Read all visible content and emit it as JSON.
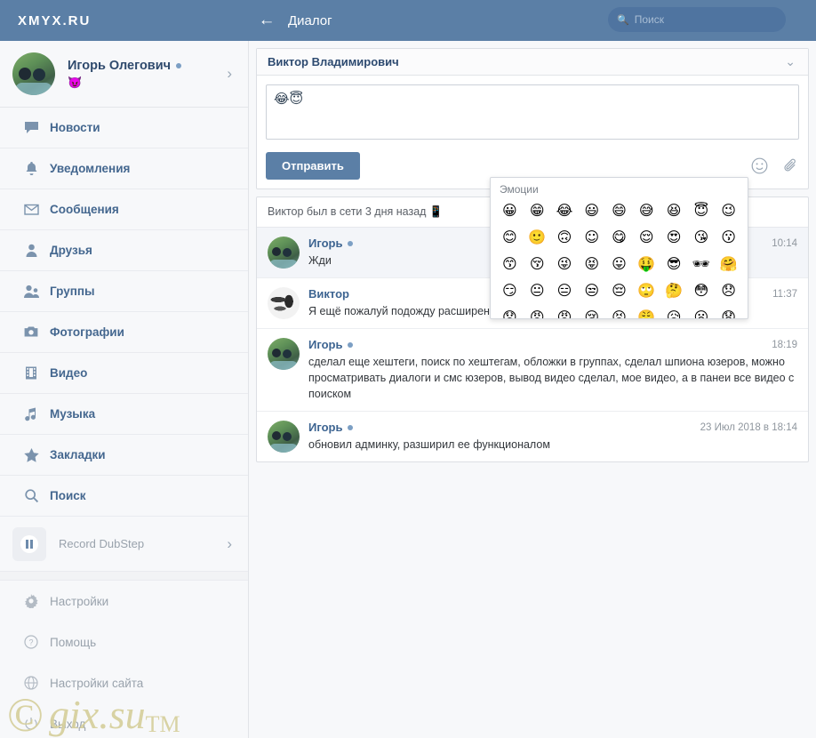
{
  "topbar": {
    "brand": "XMYX.RU",
    "back_icon": "arrow-left-icon",
    "title": "Диалог",
    "search_placeholder": "Поиск",
    "search_icon": "search-icon",
    "bg_color": "#5b7fa6"
  },
  "sidebar": {
    "profile": {
      "name": "Игорь Олегович",
      "status_emoji": "😈",
      "online": true,
      "chevron": "›"
    },
    "items": [
      {
        "label": "Новости",
        "icon": "news-bubble-icon"
      },
      {
        "label": "Уведомления",
        "icon": "bell-icon"
      },
      {
        "label": "Сообщения",
        "icon": "envelope-icon"
      },
      {
        "label": "Друзья",
        "icon": "user-icon"
      },
      {
        "label": "Группы",
        "icon": "users-icon"
      },
      {
        "label": "Фотографии",
        "icon": "camera-icon"
      },
      {
        "label": "Видео",
        "icon": "film-icon"
      },
      {
        "label": "Музыка",
        "icon": "music-note-icon"
      },
      {
        "label": "Закладки",
        "icon": "star-icon"
      },
      {
        "label": "Поиск",
        "icon": "search-icon"
      }
    ],
    "player": {
      "title": "Record DubStep",
      "button_icon": "pause-icon",
      "chevron": "›"
    },
    "footer_items": [
      {
        "label": "Настройки",
        "icon": "gear-icon"
      },
      {
        "label": "Помощь",
        "icon": "question-circle-icon"
      },
      {
        "label": "Настройки сайта",
        "icon": "globe-icon"
      },
      {
        "label": "Выход",
        "icon": "power-icon"
      }
    ]
  },
  "conversation": {
    "header_name": "Виктор Владимирович",
    "header_chevron": "⌄",
    "compose": {
      "value": "😂😇",
      "placeholder": "",
      "send_label": "Отправить",
      "emoji_icon": "smiley-face-icon",
      "attach_icon": "paperclip-icon"
    },
    "status_line": "Виктор был в сети 3 дня назад 📱",
    "messages": [
      {
        "author": "Игорь",
        "online": true,
        "text": "Жди",
        "time": "10:14",
        "avatar": "photo-two-people",
        "highlight": true
      },
      {
        "author": "Виктор",
        "online": false,
        "text": "Я ещё пожалуй подожду расширения с",
        "time": "11:37",
        "avatar": "eagle-emblem",
        "highlight": false
      },
      {
        "author": "Игорь",
        "online": true,
        "text": "сделал еще хештеги, поиск по хештегам, обложки в группах, сделал шпиона юзеров, можно просматривать диалоги и смс юзеров, вывод видео сделал, мое видео, а в панеи все видео с поиском",
        "time": "18:19",
        "avatar": "photo-two-people",
        "highlight": false
      },
      {
        "author": "Игорь",
        "online": true,
        "text": "обновил админку, разширил ее функционалом",
        "time": "23 Июл 2018 в 18:14",
        "avatar": "photo-two-people",
        "highlight": false
      }
    ]
  },
  "emoji_picker": {
    "title": "Эмоции",
    "rows": [
      [
        "😀",
        "😁",
        "😂",
        "😃",
        "😄",
        "😅",
        "😆",
        "😇",
        "😉"
      ],
      [
        "😊",
        "🙂",
        "🙃",
        "☺",
        "😋",
        "😌",
        "😍",
        "😘",
        "😗"
      ],
      [
        "😙",
        "😚",
        "😜",
        "😝",
        "😛",
        "🤑",
        "😎",
        "🕶",
        "🤗"
      ],
      [
        "😏",
        "😐",
        "😑",
        "😒",
        "😔",
        "🙄",
        "🤔",
        "😳",
        "😞"
      ],
      [
        "😟",
        "😠",
        "😡",
        "😢",
        "😣",
        "😤",
        "😥",
        "😦",
        "😧"
      ]
    ]
  },
  "watermark": {
    "mark": "©",
    "text": "gix.su",
    "tm": "TM"
  }
}
